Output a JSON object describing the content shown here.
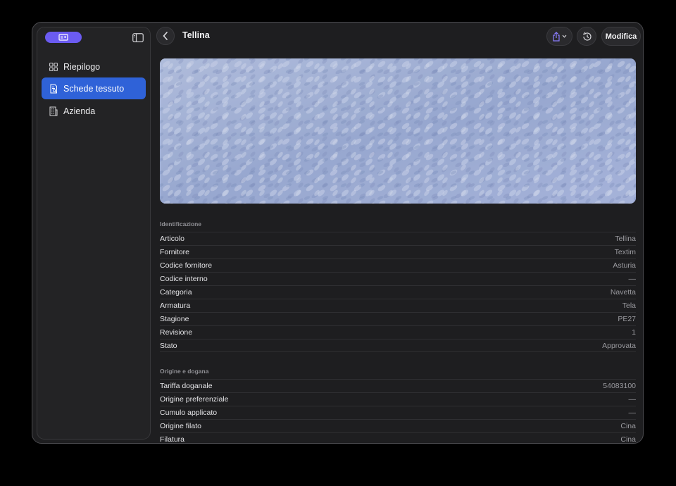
{
  "sidebar": {
    "items": [
      {
        "label": "Riepilogo",
        "icon": "grid-icon",
        "active": false
      },
      {
        "label": "Schede tessuto",
        "icon": "document-search-icon",
        "active": true
      },
      {
        "label": "Azienda",
        "icon": "building-icon",
        "active": false
      }
    ]
  },
  "header": {
    "title": "Tellina",
    "edit_label": "Modifica"
  },
  "identificazione": {
    "title": "Identificazione",
    "rows": [
      {
        "key": "Articolo",
        "value": "Tellina"
      },
      {
        "key": "Fornitore",
        "value": "Textim"
      },
      {
        "key": "Codice fornitore",
        "value": "Asturia"
      },
      {
        "key": "Codice interno",
        "value": "—"
      },
      {
        "key": "Categoria",
        "value": "Navetta"
      },
      {
        "key": "Armatura",
        "value": "Tela"
      },
      {
        "key": "Stagione",
        "value": "PE27"
      },
      {
        "key": "Revisione",
        "value": "1"
      },
      {
        "key": "Stato",
        "value": "Approvata"
      }
    ]
  },
  "origine": {
    "title": "Origine e dogana",
    "rows": [
      {
        "key": "Tariffa doganale",
        "value": "54083100"
      },
      {
        "key": "Origine preferenziale",
        "value": "—"
      },
      {
        "key": "Cumulo applicato",
        "value": "—"
      },
      {
        "key": "Origine filato",
        "value": "Cina"
      },
      {
        "key": "Filatura",
        "value": "Cina"
      }
    ]
  },
  "colors": {
    "accent": "#2f62d8",
    "badge": "#6b5bf1",
    "share_icon": "#8a7dff"
  }
}
